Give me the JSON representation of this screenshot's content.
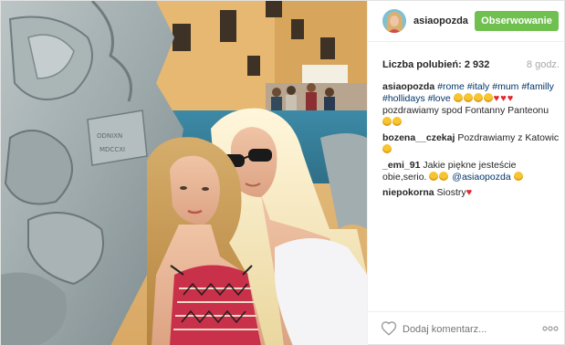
{
  "post": {
    "username": "asiaopozda",
    "follow_label": "Obserwowanie",
    "likes_label": "Liczba polubień: 2 932",
    "time_label": "8 godz."
  },
  "comments": [
    {
      "user": "asiaopozda",
      "parts": [
        {
          "type": "tag",
          "text": "#rome"
        },
        {
          "type": "tag",
          "text": "#italy"
        },
        {
          "type": "tag",
          "text": "#mum"
        },
        {
          "type": "tag",
          "text": "#familly"
        },
        {
          "type": "tag",
          "text": "#hollidays"
        },
        {
          "type": "tag",
          "text": "#love"
        }
      ],
      "trailing_text": "pozdrawiamy spod Fontanny Panteonu"
    },
    {
      "user": "bozena__czekaj",
      "text": "Pozdrawiamy z Katowic"
    },
    {
      "user": "_emi_91",
      "text": "Jakie piękne jesteście obie,serio.",
      "mention": "@asiaopozda"
    },
    {
      "user": "niepokorna",
      "text": "Siostry"
    }
  ],
  "footer": {
    "comment_placeholder": "Dodaj komentarz...",
    "like_icon": "heart-outline-icon",
    "more_icon": "ellipsis-icon"
  },
  "colors": {
    "follow_button": "#70c050",
    "hashtag": "#003569",
    "heart": "#e0282e",
    "timestamp": "#a5a7aa"
  }
}
